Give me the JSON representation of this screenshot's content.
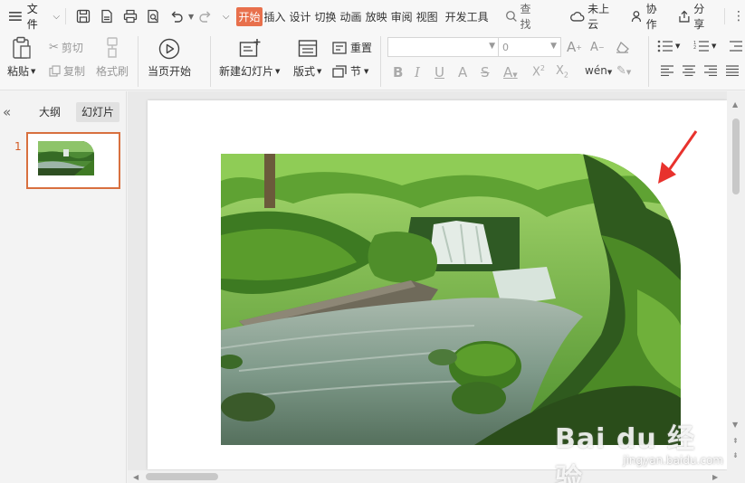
{
  "menubar": {
    "menu_label": "文件",
    "tabs": [
      {
        "label": "开始",
        "active": true
      },
      {
        "label": "插入",
        "active": false
      },
      {
        "label": "设计",
        "active": false
      },
      {
        "label": "切换",
        "active": false
      },
      {
        "label": "动画",
        "active": false
      },
      {
        "label": "放映",
        "active": false
      },
      {
        "label": "审阅",
        "active": false
      },
      {
        "label": "视图",
        "active": false
      },
      {
        "label": "开发工具",
        "active": false
      }
    ],
    "search_label": "查找",
    "cloud_label": "未上云",
    "collab_label": "协作",
    "share_label": "分享"
  },
  "ribbon": {
    "paste": "粘贴",
    "cut": "剪切",
    "copy": "复制",
    "format_painter": "格式刷",
    "from_current": "当页开始",
    "new_slide": "新建幻灯片",
    "layout": "版式",
    "reset": "重置",
    "section": "节",
    "font_name": "",
    "font_size": "0"
  },
  "leftpane": {
    "tab_outline": "大纲",
    "tab_slides": "幻灯片",
    "slide_number": "1"
  },
  "watermark": {
    "main": "Bai du 经验",
    "sub": "jingyan.baidu.com"
  },
  "colors": {
    "accent": "#e8704c",
    "thumb_border": "#d8703f",
    "annotation_arrow": "#e8322d"
  }
}
